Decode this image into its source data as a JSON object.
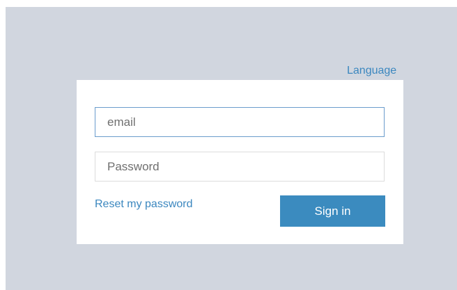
{
  "header": {
    "language_label": "Language"
  },
  "login_form": {
    "email_placeholder": "email",
    "email_value": "",
    "password_placeholder": "Password",
    "password_value": "",
    "reset_link_label": "Reset my password",
    "sign_in_label": "Sign in"
  },
  "colors": {
    "page_background": "#d1d6df",
    "card_background": "#ffffff",
    "accent": "#3b8bbf",
    "link": "#3b87bf",
    "focused_border": "#6a9ccc"
  }
}
